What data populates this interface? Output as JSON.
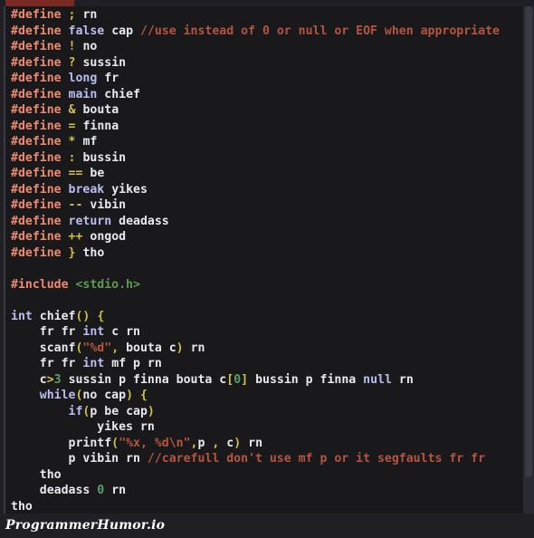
{
  "window": {
    "tab_accent_color": "#c4412e",
    "editor_background": "#19191c",
    "page_background": "#202024"
  },
  "theme": {
    "preprocessor": "#ef8a70",
    "keyword": "#b9bdf0",
    "identifier": "#e8e8ee",
    "comment": "#b5543f",
    "operator": "#cfc04a",
    "number": "#5aa06a",
    "string": "#b8553c",
    "include_path": "#5d9a52"
  },
  "code": {
    "language": "c",
    "lines": [
      "#define ; rn",
      "#define false cap //use instead of 0 or null or EOF when appropriate",
      "#define ! no",
      "#define ? sussin",
      "#define long fr",
      "#define main chief",
      "#define & bouta",
      "#define = finna",
      "#define * mf",
      "#define : bussin",
      "#define == be",
      "#define break yikes",
      "#define -- vibin",
      "#define return deadass",
      "#define ++ ongod",
      "#define } tho",
      "",
      "#include <stdio.h>",
      "",
      "int chief() {",
      "    fr fr int c rn",
      "    scanf(\"%d\", bouta c) rn",
      "    fr fr int mf p rn",
      "    c>3 sussin p finna bouta c[0] bussin p finna null rn",
      "    while(no cap) {",
      "        if(p be cap)",
      "            yikes rn",
      "        printf(\"%x, %d\\n\",p , c) rn",
      "        p vibin rn //carefull don't use mf p or it segfaults fr fr",
      "    tho",
      "    deadass 0 rn",
      "tho"
    ]
  },
  "watermark": {
    "text": "ProgrammerHumor.io"
  }
}
